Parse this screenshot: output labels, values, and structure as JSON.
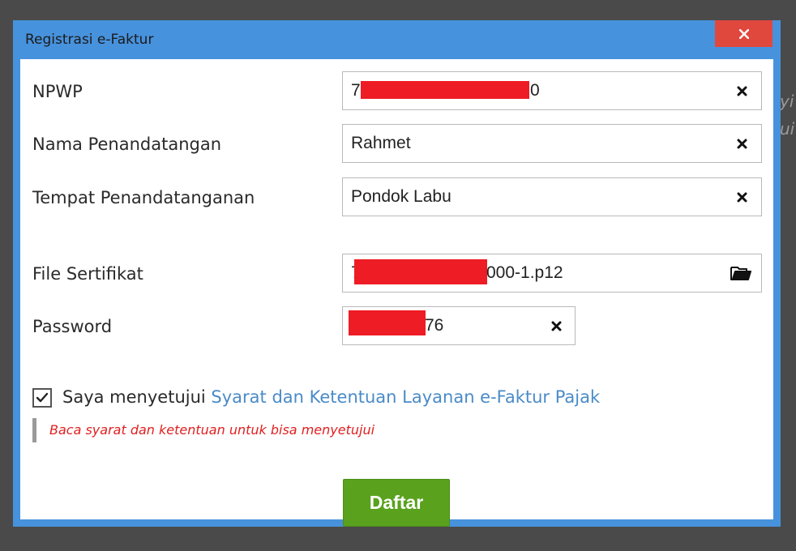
{
  "background": {
    "partial_text_1": "yi",
    "partial_text_2": "ui"
  },
  "dialog": {
    "title": "Registrasi e-Faktur",
    "close_icon": "close-x-icon"
  },
  "form": {
    "npwp": {
      "label": "NPWP",
      "value_prefix": "7",
      "value_suffix": "0",
      "clear_icon": "clear-x-icon"
    },
    "nama": {
      "label": "Nama Penandatangan",
      "value": "Rahmet",
      "clear_icon": "clear-x-icon"
    },
    "tempat": {
      "label": "Tempat Penandatanganan",
      "value": "Pondok Labu",
      "clear_icon": "clear-x-icon"
    },
    "sertifikat": {
      "label": "File Sertifikat",
      "value_prefix": "7",
      "value_suffix": "000-1.p12",
      "browse_icon": "folder-icon"
    },
    "password": {
      "label": "Password",
      "value_suffix": "76",
      "clear_icon": "clear-x-icon"
    }
  },
  "agreement": {
    "checked": true,
    "text": "Saya menyetujui",
    "link": "Syarat dan Ketentuan Layanan e-Faktur Pajak",
    "warning": "Baca syarat dan ketentuan untuk bisa menyetujui"
  },
  "submit_label": "Daftar",
  "colors": {
    "dialog_border": "#4792dd",
    "close_button": "#e0483e",
    "link": "#4a8bc8",
    "warning": "#e02020",
    "submit": "#5aa21e",
    "redaction": "#ee1c24"
  }
}
